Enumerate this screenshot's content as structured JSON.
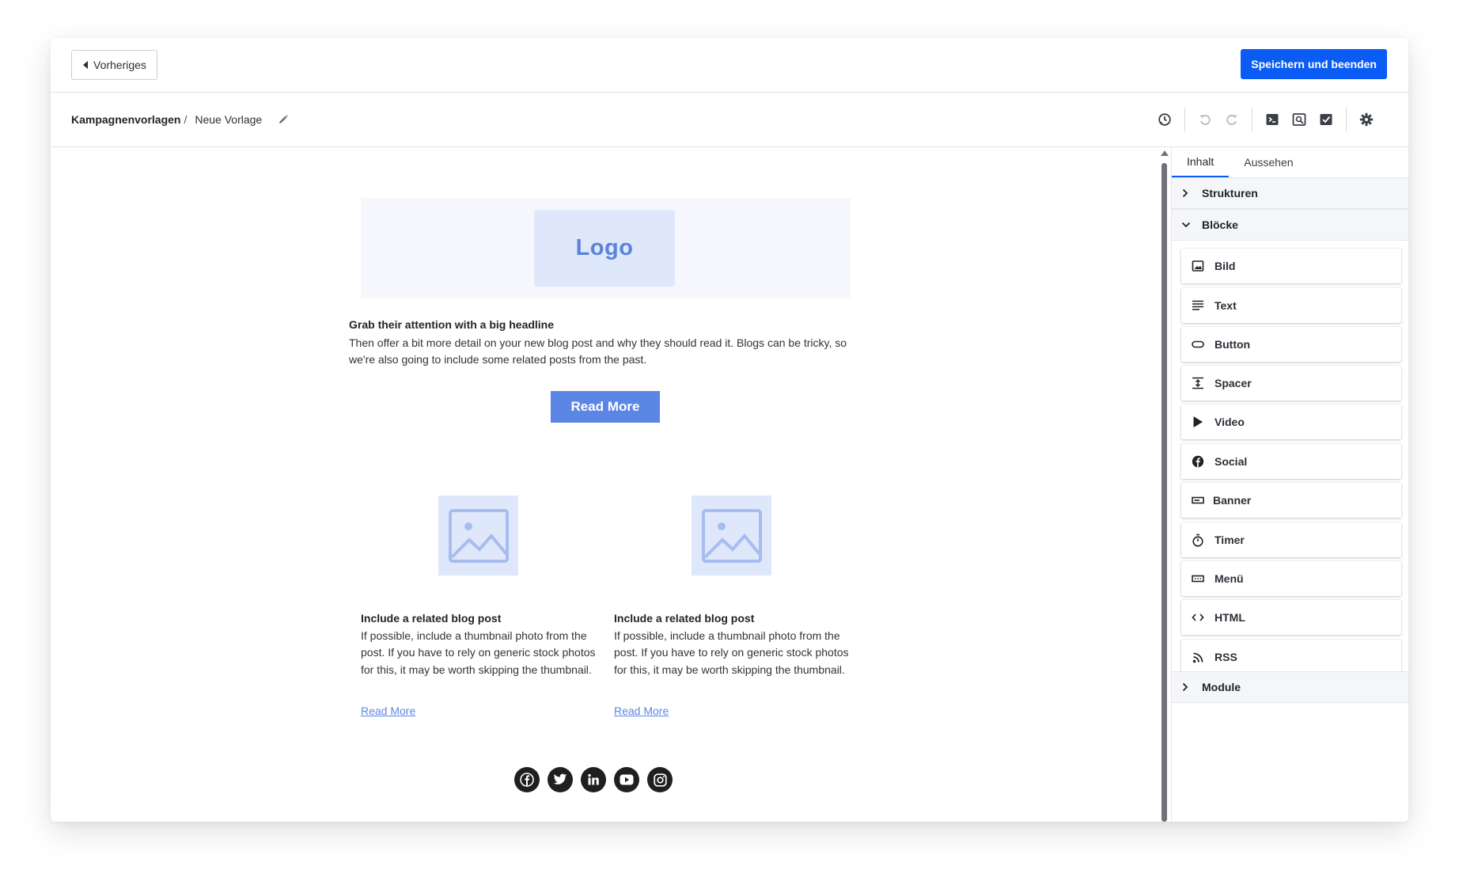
{
  "topbar": {
    "prev_label": "Vorheriges",
    "save_label": "Speichern und beenden",
    "accent": "#0a5cf5"
  },
  "breadcrumb": {
    "root": "Kampagnenvorlagen",
    "separator": "/",
    "current": "Neue Vorlage"
  },
  "toolbar": {
    "icons": [
      "history-icon",
      "undo-icon",
      "redo-icon",
      "code-icon",
      "preview-icon",
      "test-send-icon",
      "settings-icon"
    ]
  },
  "email": {
    "logo_text": "Logo",
    "headline": "Grab their attention with a big headline",
    "intro": "Then offer a bit more detail on your new blog post and why they should read it. Blogs can be tricky, so we're also going to include some related posts from the past.",
    "cta_label": "Read More",
    "columns": [
      {
        "title": "Include a related blog post",
        "body": "If possible, include a thumbnail photo from the post. If you have to rely on generic stock photos for this, it may be worth skipping the thumbnail.",
        "link": "Read More"
      },
      {
        "title": "Include a related blog post",
        "body": "If possible, include a thumbnail photo from the post. If you have to rely on generic stock photos for this, it may be worth skipping the thumbnail.",
        "link": "Read More"
      }
    ],
    "socials": [
      "facebook-icon",
      "twitter-icon",
      "linkedin-icon",
      "youtube-icon",
      "instagram-icon"
    ]
  },
  "panel": {
    "tabs": [
      {
        "label": "Inhalt",
        "active": true
      },
      {
        "label": "Aussehen",
        "active": false
      }
    ],
    "sections": {
      "structures": "Strukturen",
      "blocks": "Blöcke",
      "modules": "Module"
    },
    "blocks": [
      {
        "label": "Bild",
        "icon": "image-icon"
      },
      {
        "label": "Text",
        "icon": "text-icon"
      },
      {
        "label": "Button",
        "icon": "button-icon"
      },
      {
        "label": "Spacer",
        "icon": "spacer-icon"
      },
      {
        "label": "Video",
        "icon": "video-icon"
      },
      {
        "label": "Social",
        "icon": "social-icon"
      },
      {
        "label": "Banner",
        "icon": "banner-icon"
      },
      {
        "label": "Timer",
        "icon": "timer-icon"
      },
      {
        "label": "Menü",
        "icon": "menu-icon"
      },
      {
        "label": "HTML",
        "icon": "html-icon"
      },
      {
        "label": "RSS",
        "icon": "rss-icon"
      }
    ]
  }
}
